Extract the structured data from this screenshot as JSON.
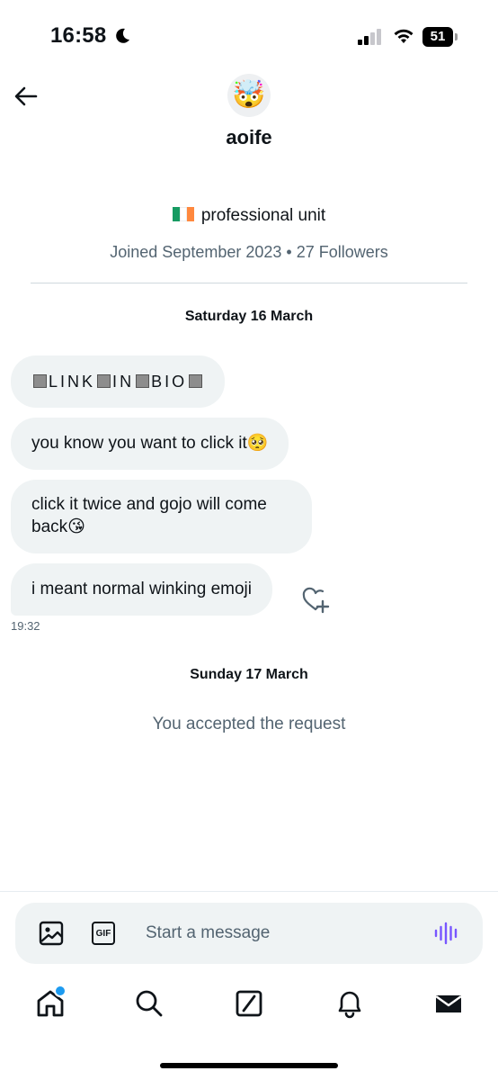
{
  "status_bar": {
    "time": "16:58",
    "battery": "51",
    "icons": [
      "moon-icon",
      "signal-icon",
      "wifi-icon",
      "battery-icon"
    ]
  },
  "header": {
    "back_icon": "arrow-left-icon",
    "avatar_emoji": "🤯",
    "name": "aoife"
  },
  "profile": {
    "bio": "professional unit",
    "bio_flag": "ireland-flag",
    "meta": "Joined September 2023 • 27 Followers"
  },
  "conversation": {
    "date_1": "Saturday 16 March",
    "messages": [
      {
        "text_parts": [
          "L",
          "I",
          "N",
          "K",
          "I",
          "N",
          "B",
          "I",
          "O"
        ]
      },
      {
        "text": "you know you want to click it🥺"
      },
      {
        "text": "click it twice and gojo will come back😘"
      },
      {
        "text": "i meant normal winking emoji"
      }
    ],
    "last_time": "19:32",
    "date_2": "Sunday 17 March",
    "system_message": "You accepted the request"
  },
  "composer": {
    "placeholder": "Start a message",
    "gif_label": "GIF",
    "accent": "#7856ff"
  },
  "nav": {
    "items": [
      "home-icon",
      "search-icon",
      "grok-icon",
      "bell-icon",
      "mail-icon"
    ],
    "dot_color": "#1d9bf0"
  }
}
